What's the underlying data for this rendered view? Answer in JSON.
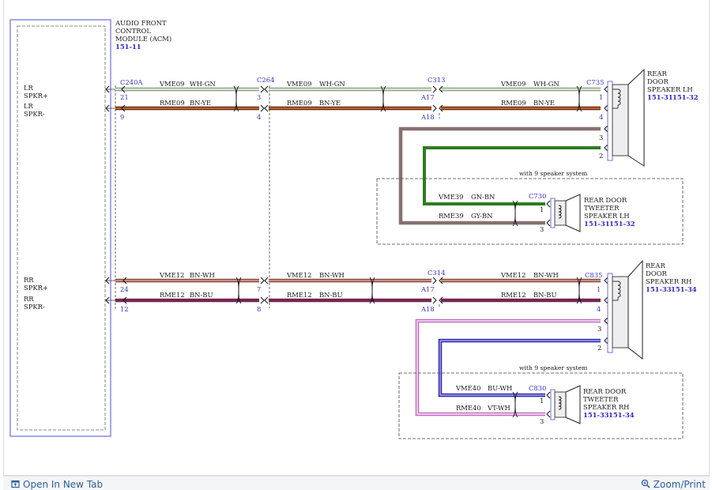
{
  "module": {
    "name_lines": [
      "AUDIO FRONT",
      "CONTROL",
      "MODULE (ACM)"
    ],
    "ref": "151-11",
    "pins": {
      "lr_plus": [
        "LR",
        "SPKR+"
      ],
      "lr_minus": [
        "LR",
        "SPKR-"
      ],
      "rr_plus": [
        "RR",
        "SPKR+"
      ],
      "rr_minus": [
        "RR",
        "SPKR-"
      ]
    }
  },
  "left_circuits": {
    "connectors": [
      "C240A",
      "C264",
      "C313",
      "C735"
    ],
    "pins_top": [
      "21",
      "3",
      "A17",
      "1"
    ],
    "pins_bottom": [
      "9",
      "4",
      "A18",
      "4"
    ],
    "wire_top_circuit": "VME09",
    "wire_top_color": "WH-GN",
    "wire_bottom_circuit": "RME09",
    "wire_bottom_color": "BN-YE"
  },
  "right_circuits": {
    "connectors": [
      "C314",
      "C835"
    ],
    "pins_top": [
      "24",
      "7",
      "A17",
      "1"
    ],
    "pins_bottom": [
      "12",
      "8",
      "A18",
      "4"
    ],
    "wire_top_circuit": "VME12",
    "wire_top_color": "BN-WH",
    "wire_bottom_circuit": "RME12",
    "wire_bottom_color": "BN-BU"
  },
  "rear_lh": {
    "name_lines": [
      "REAR",
      "DOOR",
      "SPEAKER LH"
    ],
    "refs": [
      "151-31",
      "151-32"
    ],
    "extra_pins": [
      "3",
      "2"
    ]
  },
  "rear_rh": {
    "name_lines": [
      "REAR",
      "DOOR",
      "SPEAKER RH"
    ],
    "refs": [
      "151-33",
      "151-34"
    ],
    "extra_pins": [
      "3",
      "2"
    ]
  },
  "tweeter_lh": {
    "note": "with 9 speaker system",
    "connector": "C730",
    "name_lines": [
      "REAR DOOR",
      "TWEETER",
      "SPEAKER LH"
    ],
    "refs": [
      "151-31",
      "151-32"
    ],
    "pins": [
      "1",
      "3"
    ],
    "wire_top_circuit": "VME39",
    "wire_top_color": "GN-BN",
    "wire_bottom_circuit": "RME39",
    "wire_bottom_color": "GY-BN"
  },
  "tweeter_rh": {
    "note": "with 9 speaker system",
    "connector": "C830",
    "name_lines": [
      "REAR DOOR",
      "TWEETER",
      "SPEAKER RH"
    ],
    "refs": [
      "151-33",
      "151-34"
    ],
    "pins": [
      "1",
      "3"
    ],
    "wire_top_circuit": "VME40",
    "wire_top_color": "BU-WH",
    "wire_bottom_circuit": "RME40",
    "wire_bottom_color": "VT-WH"
  },
  "colors": {
    "wh_gn": "#d6e7d2",
    "bn_ye": "#c8612b",
    "bn_wh": "#c98d7d",
    "bn_bu": "#5f2c72",
    "gy_bn": "#877070",
    "gn_bn": "#2e7d1f",
    "bu_wh": "#2d2ab0",
    "vt_wh": "#d98fd7",
    "module_border": "#6f6ce0"
  },
  "footer": {
    "open_tab": "Open In New Tab",
    "zoom_print": "Zoom/Print",
    "open_tab_icon": "external-tab-icon",
    "zoom_icon": "magnifier-icon"
  }
}
